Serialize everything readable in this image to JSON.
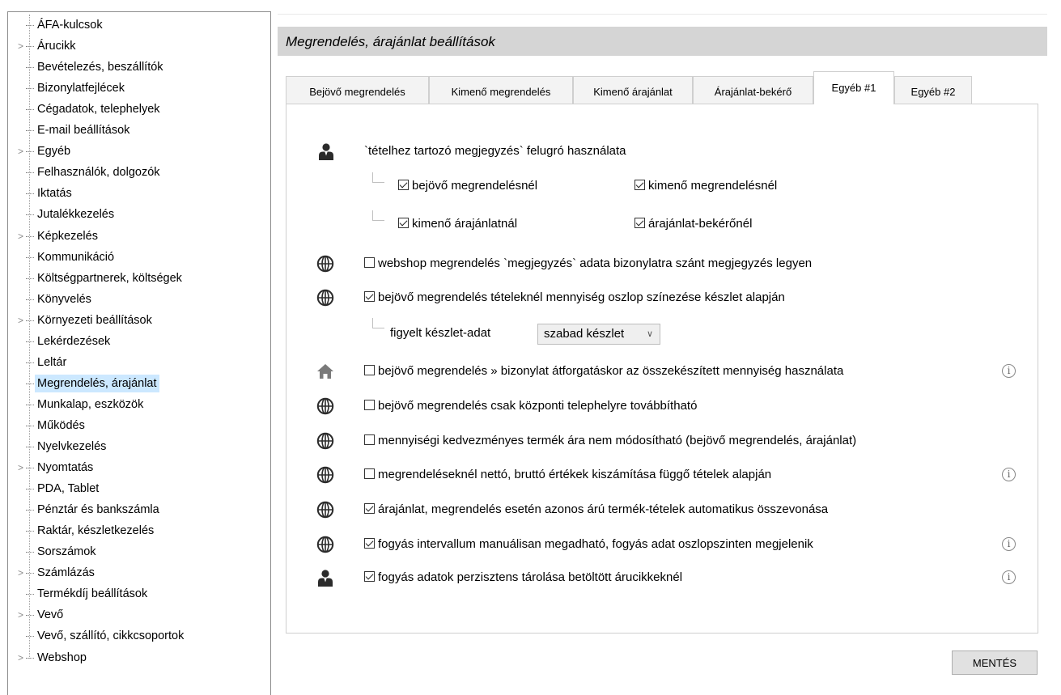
{
  "sidebar": {
    "items": [
      {
        "label": "ÁFA-kulcsok",
        "expandable": false
      },
      {
        "label": "Árucikk",
        "expandable": true
      },
      {
        "label": "Bevételezés, beszállítók",
        "expandable": false
      },
      {
        "label": "Bizonylatfejlécek",
        "expandable": false
      },
      {
        "label": "Cégadatok, telephelyek",
        "expandable": false
      },
      {
        "label": "E-mail beállítások",
        "expandable": false
      },
      {
        "label": "Egyéb",
        "expandable": true
      },
      {
        "label": "Felhasználók, dolgozók",
        "expandable": false
      },
      {
        "label": "Iktatás",
        "expandable": false
      },
      {
        "label": "Jutalékkezelés",
        "expandable": false
      },
      {
        "label": "Képkezelés",
        "expandable": true
      },
      {
        "label": "Kommunikáció",
        "expandable": false
      },
      {
        "label": "Költségpartnerek, költségek",
        "expandable": false
      },
      {
        "label": "Könyvelés",
        "expandable": false
      },
      {
        "label": "Környezeti beállítások",
        "expandable": true
      },
      {
        "label": "Lekérdezések",
        "expandable": false
      },
      {
        "label": "Leltár",
        "expandable": false
      },
      {
        "label": "Megrendelés, árajánlat",
        "expandable": false,
        "selected": true
      },
      {
        "label": "Munkalap, eszközök",
        "expandable": false
      },
      {
        "label": "Működés",
        "expandable": false
      },
      {
        "label": "Nyelvkezelés",
        "expandable": false
      },
      {
        "label": "Nyomtatás",
        "expandable": true
      },
      {
        "label": "PDA, Tablet",
        "expandable": false
      },
      {
        "label": "Pénztár és bankszámla",
        "expandable": false
      },
      {
        "label": "Raktár, készletkezelés",
        "expandable": false
      },
      {
        "label": "Sorszámok",
        "expandable": false
      },
      {
        "label": "Számlázás",
        "expandable": true
      },
      {
        "label": "Termékdíj beállítások",
        "expandable": false
      },
      {
        "label": "Vevő",
        "expandable": true
      },
      {
        "label": "Vevő, szállító, cikkcsoportok",
        "expandable": false
      },
      {
        "label": "Webshop",
        "expandable": true
      }
    ]
  },
  "header": {
    "title": "Megrendelés, árajánlat beállítások"
  },
  "tabs": [
    {
      "label": "Bejövő megrendelés"
    },
    {
      "label": "Kimenő megrendelés"
    },
    {
      "label": "Kimenő árajánlat"
    },
    {
      "label": "Árajánlat-bekérő"
    },
    {
      "label": "Egyéb #1",
      "active": true
    },
    {
      "label": "Egyéb #2"
    }
  ],
  "settings": {
    "note_popup": {
      "icon": "user-icon",
      "label": "`tételhez tartozó megjegyzés` felugró használata",
      "options": [
        {
          "label": "bejövő megrendelésnél",
          "checked": true
        },
        {
          "label": "kimenő megrendelésnél",
          "checked": true
        },
        {
          "label": "kimenő árajánlatnál",
          "checked": true
        },
        {
          "label": "árajánlat-bekérőnél",
          "checked": true
        }
      ]
    },
    "webshop_note": {
      "icon": "globe-icon",
      "label": "webshop megrendelés `megjegyzés` adata bizonylatra szánt megjegyzés legyen",
      "checked": false
    },
    "qty_coloring": {
      "icon": "globe-icon",
      "label": "bejövő megrendelés tételeknél mennyiség oszlop színezése készlet alapján",
      "checked": true,
      "sub_label": "figyelt készlet-adat",
      "select_value": "szabad készlet"
    },
    "rows": [
      {
        "icon": "home-icon",
        "label": "bejövő megrendelés » bizonylat átforgatáskor az összekészített mennyiség használata",
        "checked": false,
        "info": true
      },
      {
        "icon": "globe-icon",
        "label": "bejövő megrendelés csak központi telephelyre továbbítható",
        "checked": false,
        "info": false
      },
      {
        "icon": "globe-icon",
        "label": "mennyiségi kedvezményes termék ára nem módosítható (bejövő megrendelés, árajánlat)",
        "checked": false,
        "info": false
      },
      {
        "icon": "globe-icon",
        "label": "megrendeléseknél nettó, bruttó értékek kiszámítása függő tételek alapján",
        "checked": false,
        "info": true
      },
      {
        "icon": "globe-icon",
        "label": "árajánlat, megrendelés esetén azonos árú termék-tételek automatikus összevonása",
        "checked": true,
        "info": false
      },
      {
        "icon": "globe-icon",
        "label": "fogyás intervallum manuálisan megadható, fogyás adat oszlopszinten megjelenik",
        "checked": true,
        "info": true
      },
      {
        "icon": "user-icon",
        "label": "fogyás adatok perzisztens tárolása betöltött árucikkeknél",
        "checked": true,
        "info": true
      }
    ]
  },
  "info_glyph": "i",
  "dropdown_glyph": "∨",
  "chevron_glyph": ">",
  "save_label": "MENTÉS"
}
